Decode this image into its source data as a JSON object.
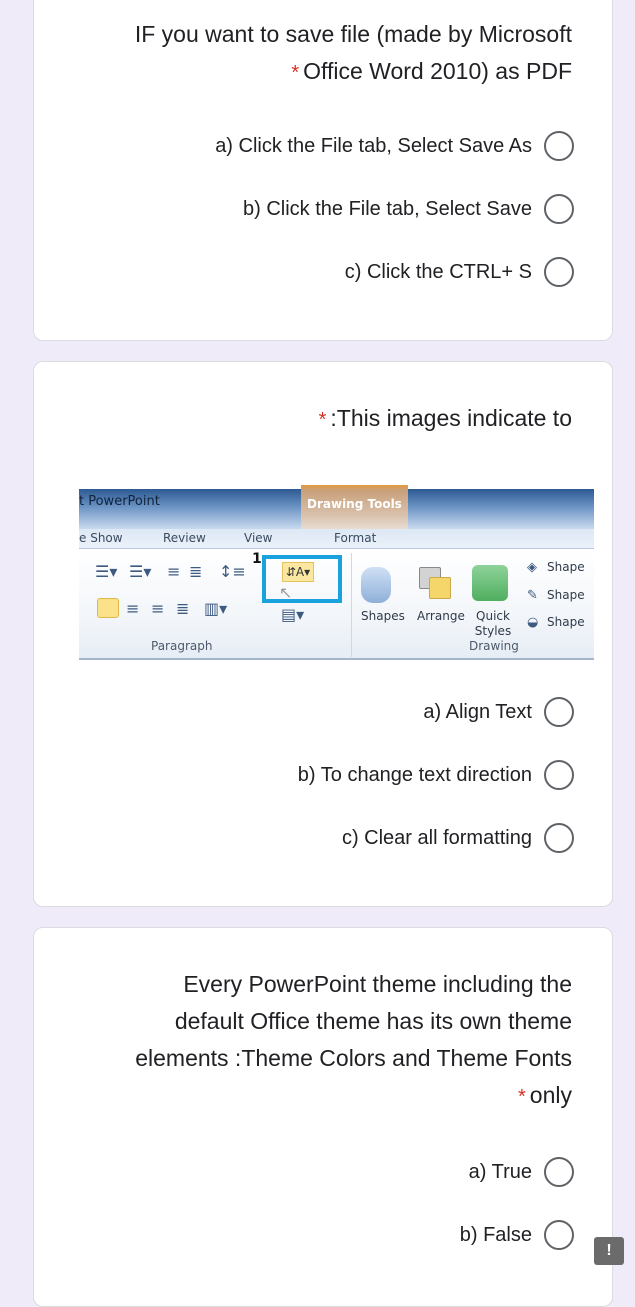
{
  "questions": [
    {
      "title_line1": "IF you want to save file (made by Microsoft",
      "title_line2": "Office Word 2010) as PDF",
      "required_mark": "*",
      "options": [
        {
          "label": "a) Click the File tab, Select Save As",
          "selected": false
        },
        {
          "label": "b) Click the File tab, Select Save",
          "selected": false
        },
        {
          "label": "c) Click the CTRL+ S",
          "selected": false
        }
      ]
    },
    {
      "title": ":This images indicate to",
      "required_mark": "*",
      "image": {
        "app_title": "t PowerPoint",
        "contextual_tab_group": "Drawing Tools",
        "tabs": [
          "e Show",
          "Review",
          "View",
          "Format"
        ],
        "callout_number": "1",
        "groups": [
          "Paragraph",
          "Drawing"
        ],
        "drawing_buttons": [
          "Shapes",
          "Arrange",
          "Quick Styles"
        ],
        "shape_commands": [
          "Shape",
          "Shape",
          "Shape"
        ]
      },
      "options": [
        {
          "label": "a) Align Text",
          "selected": false
        },
        {
          "label": "b) To change text direction",
          "selected": false
        },
        {
          "label": "c) Clear all formatting",
          "selected": false
        }
      ]
    },
    {
      "title_lines": [
        "Every PowerPoint theme including the",
        "default Office theme has its own theme",
        "elements :Theme Colors and Theme Fonts"
      ],
      "title_last": "only",
      "required_mark": "*",
      "options": [
        {
          "label": "a) True",
          "selected": false
        },
        {
          "label": "b) False",
          "selected": false
        }
      ]
    }
  ],
  "feedback_button": "!",
  "colors": {
    "background": "#f0ebf8",
    "required": "#d93025",
    "radio_border": "#5f6368",
    "highlight": "#19a2de"
  }
}
